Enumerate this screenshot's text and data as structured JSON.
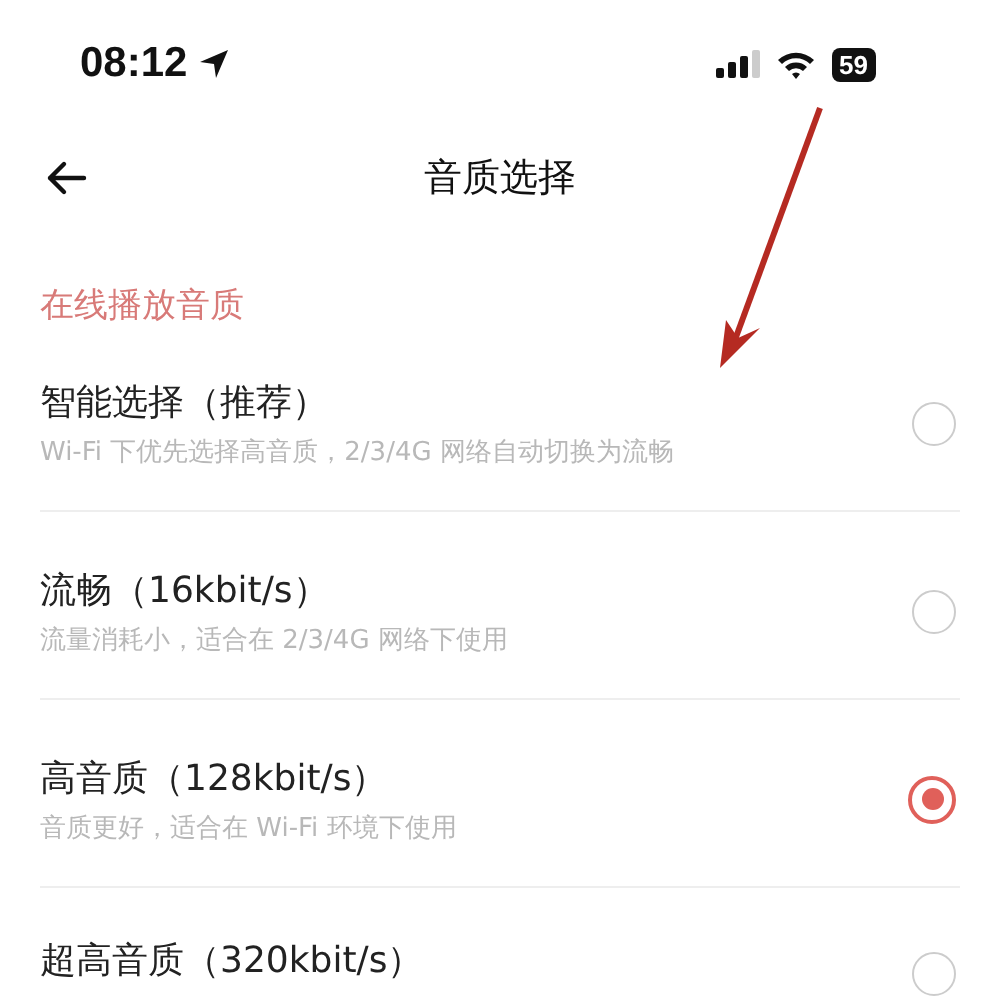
{
  "status_bar": {
    "time": "08:12",
    "battery": "59"
  },
  "header": {
    "title": "音质选择"
  },
  "section": {
    "label": "在线播放音质"
  },
  "options": [
    {
      "title": "智能选择（推荐）",
      "subtitle": "Wi-Fi 下优先选择高音质，2/3/4G 网络自动切换为流畅",
      "selected": false
    },
    {
      "title": "流畅（16kbit/s）",
      "subtitle": "流量消耗小，适合在 2/3/4G 网络下使用",
      "selected": false
    },
    {
      "title": "高音质（128kbit/s）",
      "subtitle": "音质更好，适合在 Wi-Fi 环境下使用",
      "selected": true
    },
    {
      "title": "超高音质（320kbit/s）",
      "selected": false
    }
  ]
}
